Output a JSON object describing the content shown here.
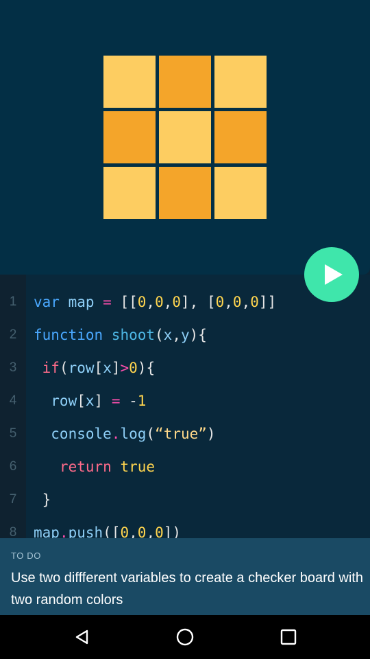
{
  "preview": {
    "grid_colors": [
      "#fdcd61",
      "#f4a52a",
      "#fdcd61",
      "#f4a52a",
      "#fdcd61",
      "#f4a52a",
      "#fdcd61",
      "#f4a52a",
      "#fdcd61"
    ]
  },
  "play_button": {
    "icon": "play-icon",
    "color": "#3fe6ab"
  },
  "editor": {
    "lines": [
      {
        "n": "1",
        "tokens": [
          {
            "t": "var",
            "c": "kw"
          },
          {
            "t": " map ",
            "c": "var"
          },
          {
            "t": "=",
            "c": "op"
          },
          {
            "t": " [[",
            "c": "pun"
          },
          {
            "t": "0",
            "c": "num"
          },
          {
            "t": ",",
            "c": "pun"
          },
          {
            "t": "0",
            "c": "num"
          },
          {
            "t": ",",
            "c": "pun"
          },
          {
            "t": "0",
            "c": "num"
          },
          {
            "t": "], [",
            "c": "pun"
          },
          {
            "t": "0",
            "c": "num"
          },
          {
            "t": ",",
            "c": "pun"
          },
          {
            "t": "0",
            "c": "num"
          },
          {
            "t": ",",
            "c": "pun"
          },
          {
            "t": "0",
            "c": "num"
          },
          {
            "t": "]]",
            "c": "pun"
          }
        ]
      },
      {
        "n": "2",
        "tokens": [
          {
            "t": "function",
            "c": "kw"
          },
          {
            "t": " shoot",
            "c": "fn"
          },
          {
            "t": "(",
            "c": "pun"
          },
          {
            "t": "x",
            "c": "var"
          },
          {
            "t": ",",
            "c": "pun"
          },
          {
            "t": "y",
            "c": "var"
          },
          {
            "t": "){",
            "c": "pun"
          }
        ]
      },
      {
        "n": "3",
        "tokens": [
          {
            "t": " if",
            "c": "red"
          },
          {
            "t": "(",
            "c": "pun"
          },
          {
            "t": "row",
            "c": "var"
          },
          {
            "t": "[",
            "c": "pun"
          },
          {
            "t": "x",
            "c": "var"
          },
          {
            "t": "]",
            "c": "pun"
          },
          {
            "t": ">",
            "c": "op"
          },
          {
            "t": "0",
            "c": "num"
          },
          {
            "t": "){",
            "c": "pun"
          }
        ]
      },
      {
        "n": "4",
        "tokens": [
          {
            "t": "  row",
            "c": "var"
          },
          {
            "t": "[",
            "c": "pun"
          },
          {
            "t": "x",
            "c": "var"
          },
          {
            "t": "] ",
            "c": "pun"
          },
          {
            "t": "=",
            "c": "op"
          },
          {
            "t": " -",
            "c": "pun"
          },
          {
            "t": "1",
            "c": "num"
          }
        ]
      },
      {
        "n": "5",
        "tokens": [
          {
            "t": "  console",
            "c": "var"
          },
          {
            "t": ".",
            "c": "op"
          },
          {
            "t": "log",
            "c": "var"
          },
          {
            "t": "(",
            "c": "pun"
          },
          {
            "t": "“true”",
            "c": "str"
          },
          {
            "t": ")",
            "c": "pun"
          }
        ]
      },
      {
        "n": "6",
        "tokens": [
          {
            "t": "   return",
            "c": "red"
          },
          {
            "t": " true",
            "c": "num"
          }
        ]
      },
      {
        "n": "7",
        "tokens": [
          {
            "t": " }",
            "c": "pun"
          }
        ]
      },
      {
        "n": "8",
        "tokens": [
          {
            "t": "map",
            "c": "var"
          },
          {
            "t": ".",
            "c": "op"
          },
          {
            "t": "push",
            "c": "var"
          },
          {
            "t": "([",
            "c": "pun"
          },
          {
            "t": "0",
            "c": "num"
          },
          {
            "t": ",",
            "c": "pun"
          },
          {
            "t": "0",
            "c": "num"
          },
          {
            "t": ",",
            "c": "pun"
          },
          {
            "t": "0",
            "c": "num"
          },
          {
            "t": "])",
            "c": "pun"
          }
        ]
      }
    ]
  },
  "todo": {
    "label": "TO DO",
    "text": "Use two diffferent variables to create a checker board with two random colors"
  },
  "navbar": {
    "back_icon": "back-triangle-icon",
    "home_icon": "home-circle-icon",
    "recents_icon": "recents-square-icon"
  }
}
